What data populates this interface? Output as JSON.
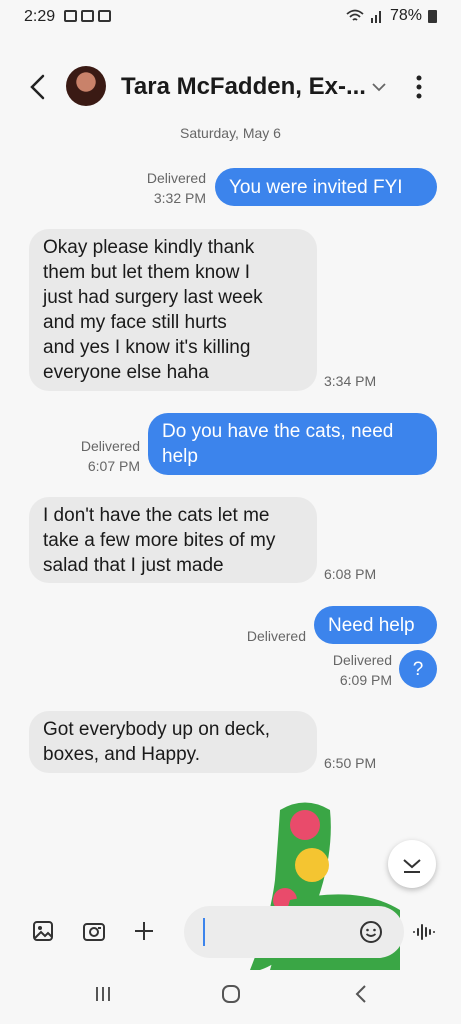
{
  "status_bar": {
    "time": "2:29",
    "battery": "78%"
  },
  "header": {
    "contact_name": "Tara McFadden, Ex-..."
  },
  "date_separator": "Saturday, May 6",
  "messages": [
    {
      "dir": "sent",
      "text": "You were invited FYI",
      "status": "Delivered",
      "time": "3:32 PM"
    },
    {
      "dir": "recv",
      "lines": [
        "Okay please kindly thank",
        "them but let them know I",
        "just had surgery last week",
        "and my face still hurts",
        "and yes I know it's killing",
        "everyone else haha"
      ],
      "time": "3:34 PM"
    },
    {
      "dir": "sent",
      "lines": [
        "Do you have the cats, need",
        "help"
      ],
      "status": "Delivered",
      "time": "6:07 PM"
    },
    {
      "dir": "recv",
      "lines": [
        "I don't have the cats let me",
        "take a few more bites of my",
        "salad that I just made"
      ],
      "time": "6:08 PM"
    },
    {
      "dir": "sent",
      "text": "Need help",
      "status": "Delivered"
    },
    {
      "dir": "sent",
      "text": "?",
      "status": "Delivered",
      "time": "6:09 PM"
    },
    {
      "dir": "recv",
      "lines": [
        "Got everybody up on deck,",
        "boxes, and Happy."
      ],
      "time": "6:50 PM"
    }
  ],
  "composer": {
    "placeholder": ""
  },
  "icons": {
    "back": "arrow-left-icon",
    "more": "kebab-icon",
    "expand": "chevron-down-icon",
    "gallery": "image-icon",
    "camera": "camera-icon",
    "add": "plus-icon",
    "emoji": "emoji-icon",
    "voice": "waveform-icon",
    "nav_recents": "recents-icon",
    "nav_home": "home-icon",
    "nav_back": "nav-back-icon"
  },
  "colors": {
    "sent_bubble": "#3c84ec",
    "recv_bubble": "#e9e9e9",
    "background": "#f7f7f7"
  }
}
